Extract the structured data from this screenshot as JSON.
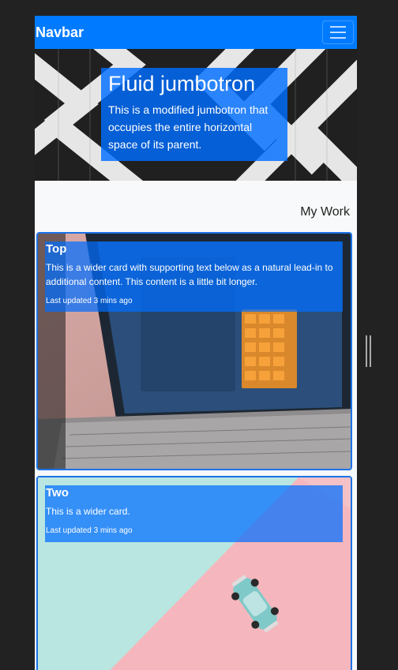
{
  "navbar": {
    "brand": "Navbar",
    "toggler_icon": "hamburger-icon"
  },
  "jumbotron": {
    "title": "Fluid jumbotron",
    "lead": "This is a modified jumbotron that occupies the entire horizontal space of its parent."
  },
  "section": {
    "title": "My Work"
  },
  "cards": [
    {
      "title": "Top",
      "text": "This is a wider card with supporting text below as a natural lead-in to additional content. This content is a little bit longer.",
      "meta": "Last updated 3 mins ago",
      "image": "laptop-calculator-photo"
    },
    {
      "title": "Two",
      "text": "This is a wider card.",
      "meta": "Last updated 3 mins ago",
      "image": "toy-car-pastel-photo"
    }
  ],
  "colors": {
    "primary": "#007bff",
    "page_bg": "#f8f9fa",
    "outer_bg": "#222222"
  }
}
